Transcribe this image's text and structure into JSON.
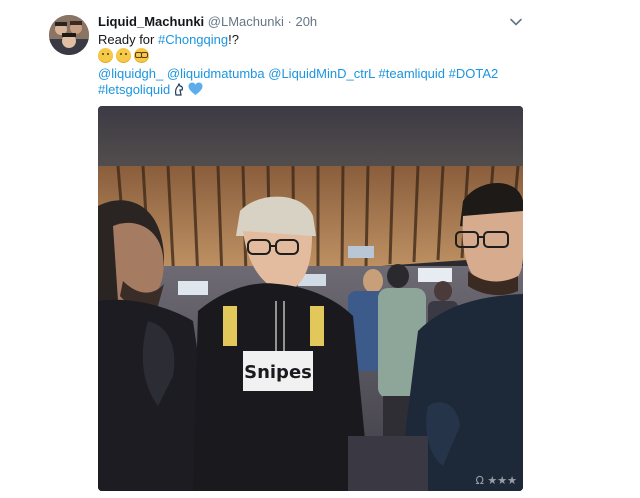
{
  "tweet": {
    "display_name": "Liquid_Machunki",
    "handle": "@LMachunki",
    "separator": "·",
    "time": "20h",
    "text_prefix": "Ready for ",
    "hashtag_main": "#Chongqing",
    "text_suffix": "!?",
    "emojis": [
      "thinking-face",
      "smirking-face",
      "nerd-face"
    ],
    "mentions": [
      "@liquidgh_",
      "@liquidmatumba",
      "@LiquidMinD_ctrL"
    ],
    "hashtags": [
      "#teamliquid",
      "#DOTA2",
      "#letsgoliquid"
    ],
    "image_hoodie_text": "Snipes",
    "watermark": "Ω ★★★"
  },
  "colors": {
    "link": "#1b95e0",
    "muted": "#657786",
    "heart": "#5dadec"
  }
}
